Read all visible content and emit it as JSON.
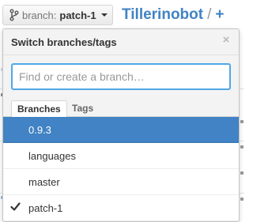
{
  "header": {
    "branch_prefix": "branch:",
    "branch_name": "patch-1",
    "repo_name": "Tillerinobot",
    "separator": "/",
    "plus": "+"
  },
  "dropdown": {
    "title": "Switch branches/tags",
    "close_glyph": "×",
    "filter": {
      "value": "",
      "placeholder": "Find or create a branch…"
    },
    "tabs": [
      {
        "label": "Branches",
        "active": true
      },
      {
        "label": "Tags",
        "active": false
      }
    ],
    "items": [
      {
        "label": "0.9.3",
        "highlighted": true,
        "checked": false
      },
      {
        "label": "languages",
        "highlighted": false,
        "checked": false
      },
      {
        "label": "master",
        "highlighted": false,
        "checked": false
      },
      {
        "label": "patch-1",
        "highlighted": false,
        "checked": true
      }
    ]
  },
  "colors": {
    "link": "#4183c4",
    "highlight": "#4183c4",
    "focus_border": "#51a7e8"
  },
  "icons": {
    "branch": "git-branch-icon",
    "caret": "chevron-down-icon",
    "close": "close-icon",
    "check": "check-icon"
  }
}
